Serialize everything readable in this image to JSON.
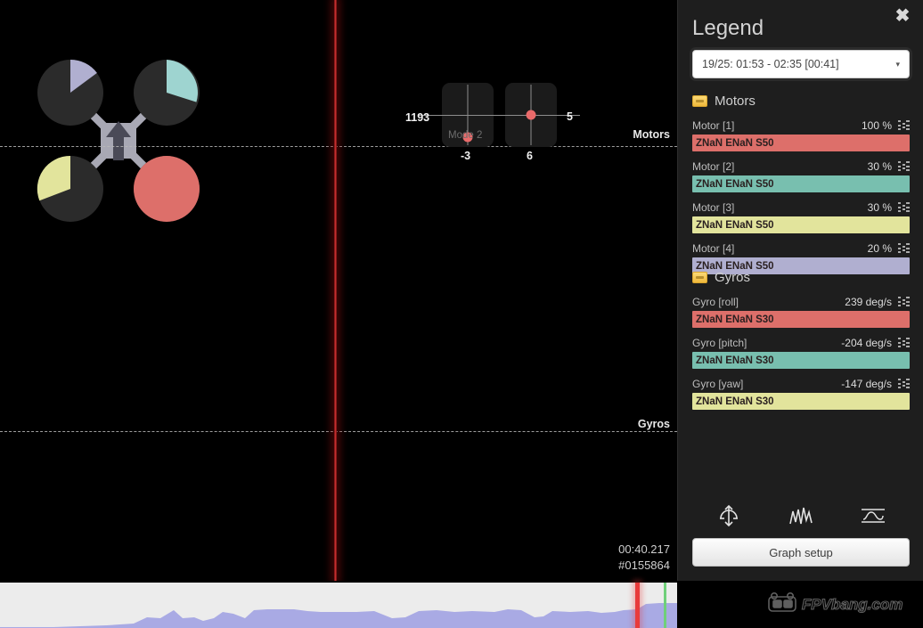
{
  "legend": {
    "title": "Legend",
    "close_label": "✖",
    "range_value": "19/25: 01:53 - 02:35 [00:41]",
    "caret": "▾",
    "groups": [
      {
        "name": "Motors",
        "icon": "folder-icon",
        "fields": [
          {
            "name": "Motor [1]",
            "value": "100 %",
            "bar_text": "ZNaN ENaN S50",
            "color": "#dd6f6a",
            "fill_pct": 100
          },
          {
            "name": "Motor [2]",
            "value": "30 %",
            "bar_text": "ZNaN ENaN S50",
            "color": "#78bfaf",
            "fill_pct": 100
          },
          {
            "name": "Motor [3]",
            "value": "30 %",
            "bar_text": "ZNaN ENaN S50",
            "color": "#e2e49c",
            "fill_pct": 100
          },
          {
            "name": "Motor [4]",
            "value": "20 %",
            "bar_text": "ZNaN ENaN S50",
            "color": "#b0afd0",
            "fill_pct": 100
          }
        ]
      },
      {
        "name": "Gyros",
        "icon": "folder-icon",
        "fields": [
          {
            "name": "Gyro [roll]",
            "value": "239 deg/s",
            "bar_text": "ZNaN ENaN S30",
            "color": "#dd6f6a",
            "fill_pct": 100
          },
          {
            "name": "Gyro [pitch]",
            "value": "-204 deg/s",
            "bar_text": "ZNaN ENaN S30",
            "color": "#78bfaf",
            "fill_pct": 100
          },
          {
            "name": "Gyro [yaw]",
            "value": "-147 deg/s",
            "bar_text": "ZNaN ENaN S30",
            "color": "#e2e49c",
            "fill_pct": 100
          }
        ]
      }
    ],
    "tools": [
      {
        "name": "analyser-icon"
      },
      {
        "name": "spectrum-icon"
      },
      {
        "name": "waveform-box-icon"
      }
    ],
    "graph_setup_label": "Graph setup"
  },
  "graph": {
    "axis_labels": [
      "Motors",
      "Gyros"
    ],
    "timestamp": "00:40.217",
    "frame": "#0155864"
  },
  "sticks": {
    "mode_label": "Mode 2",
    "left": {
      "value_left": "1193",
      "value_bottom": "-3"
    },
    "right": {
      "value_right": "5",
      "value_bottom": "6"
    }
  },
  "craft": {
    "motor_colors": [
      "#dd6f6a",
      "#78bfaf",
      "#e2e49c",
      "#b0afd0"
    ],
    "motor_pct": [
      100,
      30,
      30,
      20
    ]
  },
  "watermark": {
    "text": "FPVbang.com"
  }
}
